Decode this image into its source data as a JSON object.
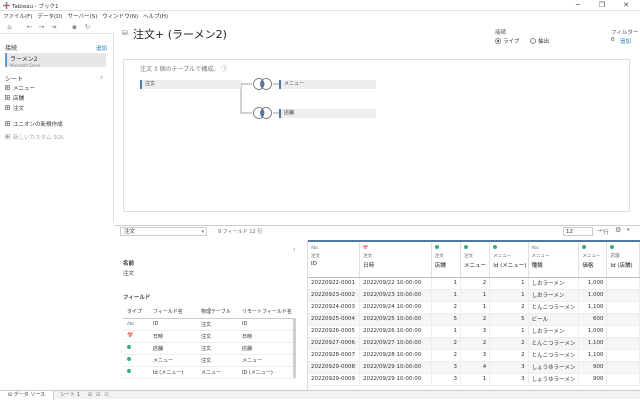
{
  "window": {
    "title": "Tableau - ブック1",
    "min": "─",
    "restore": "❐",
    "close": "✕"
  },
  "menu": [
    "ファイル(F)",
    "データ(D)",
    "サーバー(S)",
    "ウィンドウ(N)",
    "ヘルプ(H)"
  ],
  "left": {
    "connections_label": "接続",
    "connections_add": "追加",
    "connection_name": "ラーメン2",
    "connection_type": "Microsoft Excel",
    "sheets_label": "シート",
    "sheets": [
      "メニュー",
      "店舗",
      "注文"
    ],
    "new_union": "ユニオンの新規作成",
    "new_custom_sql": "新しいカスタム SQL"
  },
  "header": {
    "title": "注文+ (ラーメン2)",
    "connection_label": "接続",
    "live": "ライブ",
    "extract": "抽出",
    "filter_label": "フィルター",
    "filter_count": "0",
    "filter_add": "追加"
  },
  "canvas": {
    "caption": "注文 3 個のテーブルで構成。",
    "tables": {
      "root": "注文",
      "menu": "メニュー",
      "store": "店舗"
    }
  },
  "gridbar": {
    "table_select": "注文",
    "field_count": "9 フィールド 12 行",
    "rows": "12",
    "rows_label": "行"
  },
  "meta": {
    "name_label": "名前",
    "name_value": "注文",
    "fields_label": "フィールド",
    "columns": [
      "タイプ",
      "フィールド名",
      "物理テーブル",
      "リモートフィールド名"
    ],
    "rows": [
      {
        "type": "Abc",
        "name": "ID",
        "table": "注文",
        "remote": "ID"
      },
      {
        "type": "calendar",
        "name": "日時",
        "table": "注文",
        "remote": "日時"
      },
      {
        "type": "number",
        "name": "店舗",
        "table": "注文",
        "remote": "店舗"
      },
      {
        "type": "number",
        "name": "メニュー",
        "table": "注文",
        "remote": "メニュー"
      },
      {
        "type": "number",
        "name": "Id (メニュー)",
        "table": "メニュー",
        "remote": "ID (メニュー)"
      }
    ]
  },
  "grid": {
    "columns": [
      {
        "type": "Abc",
        "source": "注文",
        "name": "ID"
      },
      {
        "type": "calendar",
        "source": "注文",
        "name": "日時"
      },
      {
        "type": "number",
        "source": "注文",
        "name": "店舗"
      },
      {
        "type": "number",
        "source": "注文",
        "name": "メニュー"
      },
      {
        "type": "number",
        "source": "メニュー",
        "name": "Id (メニュー)"
      },
      {
        "type": "Abc",
        "source": "メニュー",
        "name": "種類"
      },
      {
        "type": "number",
        "source": "メニュー",
        "name": "価格"
      },
      {
        "type": "number",
        "source": "店舗",
        "name": "Id (店舗)"
      }
    ],
    "rows": [
      [
        "20220922-0001",
        "2022/09/22 10:00:00",
        "1",
        "2",
        "1",
        "しおラーメン",
        "1,000",
        ""
      ],
      [
        "20220923-0002",
        "2022/09/23 10:00:00",
        "1",
        "1",
        "1",
        "しおラーメン",
        "1,000",
        ""
      ],
      [
        "20220924-0003",
        "2022/09/24 10:00:00",
        "2",
        "1",
        "2",
        "とんこつラーメン",
        "1,100",
        ""
      ],
      [
        "20220925-0004",
        "2022/09/25 10:00:00",
        "5",
        "2",
        "5",
        "ビール",
        "600",
        ""
      ],
      [
        "20220926-0005",
        "2022/09/26 10:00:00",
        "1",
        "3",
        "1",
        "しおラーメン",
        "1,000",
        ""
      ],
      [
        "20220927-0006",
        "2022/09/27 10:00:00",
        "2",
        "2",
        "2",
        "とんこつラーメン",
        "1,100",
        ""
      ],
      [
        "20220928-0007",
        "2022/09/28 10:00:00",
        "2",
        "3",
        "2",
        "とんこつラーメン",
        "1,100",
        ""
      ],
      [
        "20220929-0008",
        "2022/09/29 10:00:00",
        "3",
        "4",
        "3",
        "しょうゆラーメン",
        "900",
        ""
      ],
      [
        "20220929-0009",
        "2022/09/29 10:00:00",
        "3",
        "1",
        "3",
        "しょうゆラーメン",
        "900",
        ""
      ]
    ]
  },
  "bottom": {
    "datasource_tab": "データ ソース",
    "sheet_tab": "シート 1"
  },
  "colors": {
    "accent": "#4e79a7",
    "number_icon": "#3aa888",
    "link": "#1f77b4"
  }
}
